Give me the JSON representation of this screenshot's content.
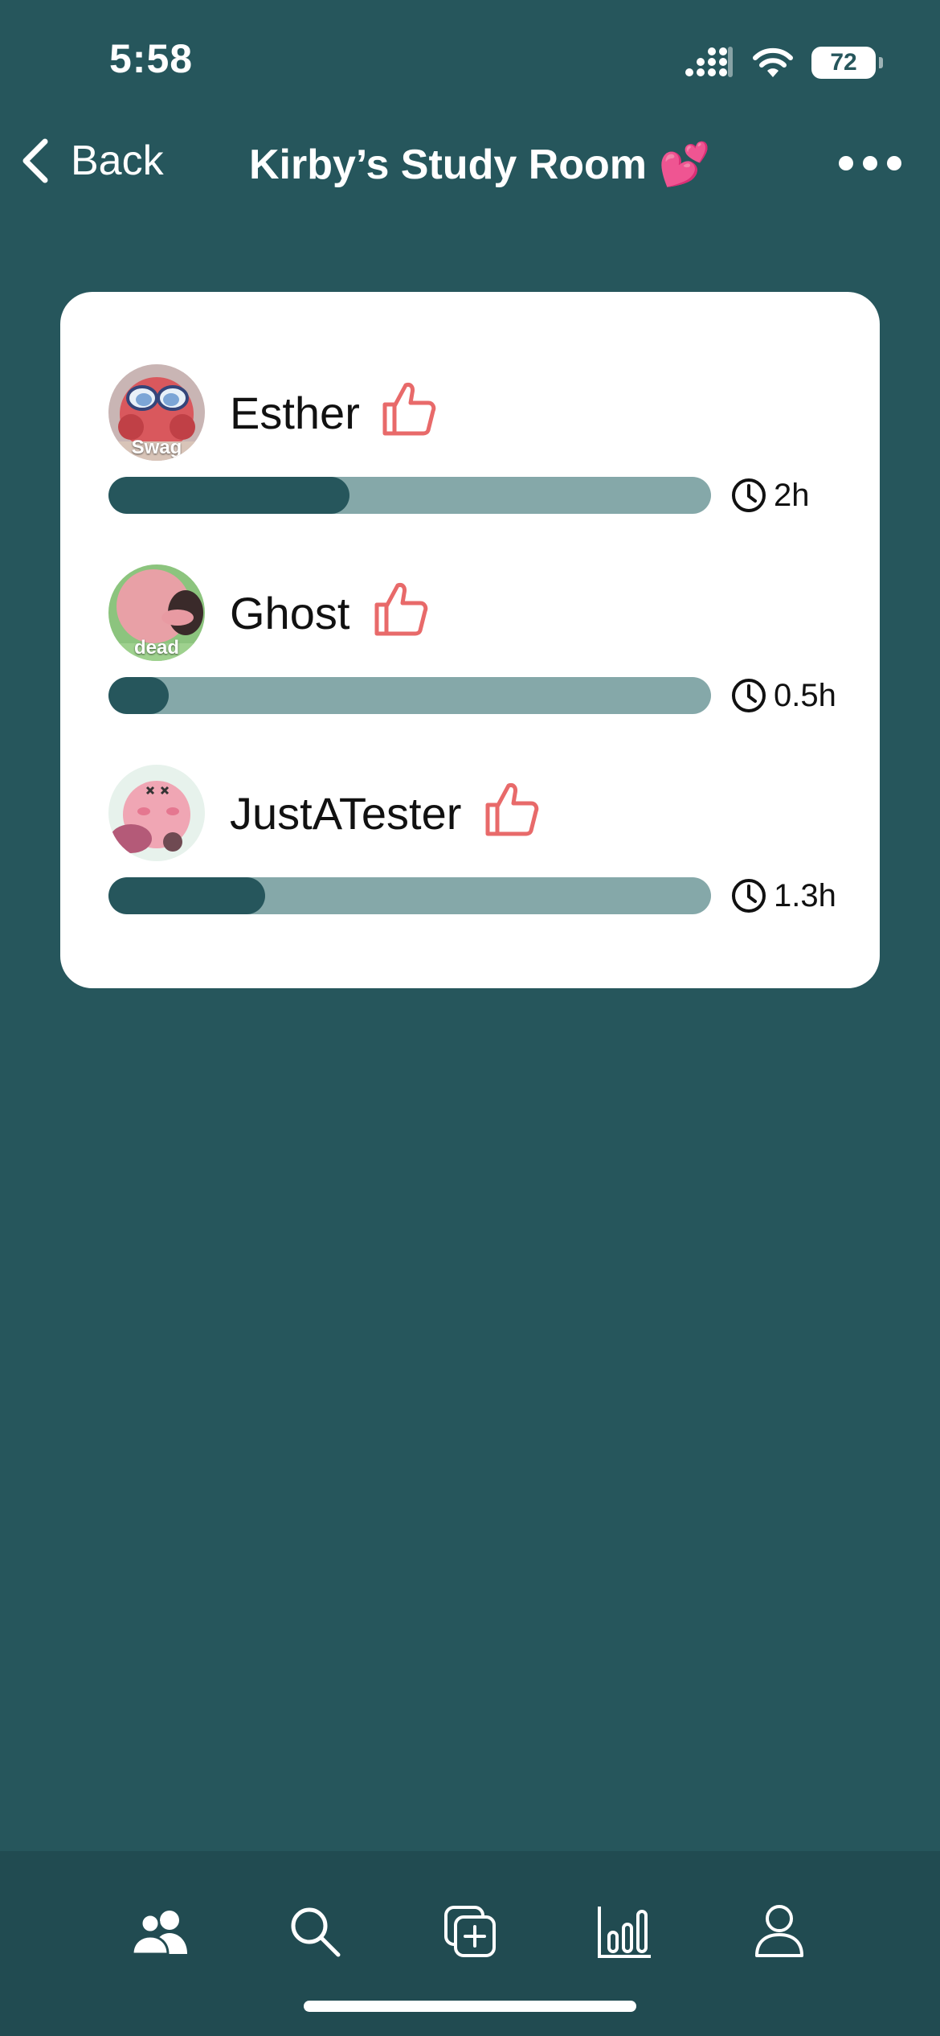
{
  "status_bar": {
    "time": "5:58",
    "battery": "72"
  },
  "nav": {
    "back_label": "Back",
    "title": "Kirby’s Study Room 💕"
  },
  "members": [
    {
      "name": "Esther",
      "avatar_caption": "Swag",
      "study_time": "2h",
      "progress": 0.4
    },
    {
      "name": "Ghost",
      "avatar_caption": "dead",
      "study_time": "0.5h",
      "progress": 0.1
    },
    {
      "name": "JustATester",
      "avatar_caption": "",
      "study_time": "1.3h",
      "progress": 0.26
    }
  ],
  "tabs": [
    {
      "icon": "people-icon"
    },
    {
      "icon": "search-icon"
    },
    {
      "icon": "add-room-icon"
    },
    {
      "icon": "stats-icon"
    },
    {
      "icon": "profile-icon"
    }
  ],
  "colors": {
    "background": "#26565c",
    "tab_bar": "#214b51",
    "progress_track": "#85a8a9",
    "progress_fill": "#26565c",
    "like_accent": "#e86a6a"
  }
}
